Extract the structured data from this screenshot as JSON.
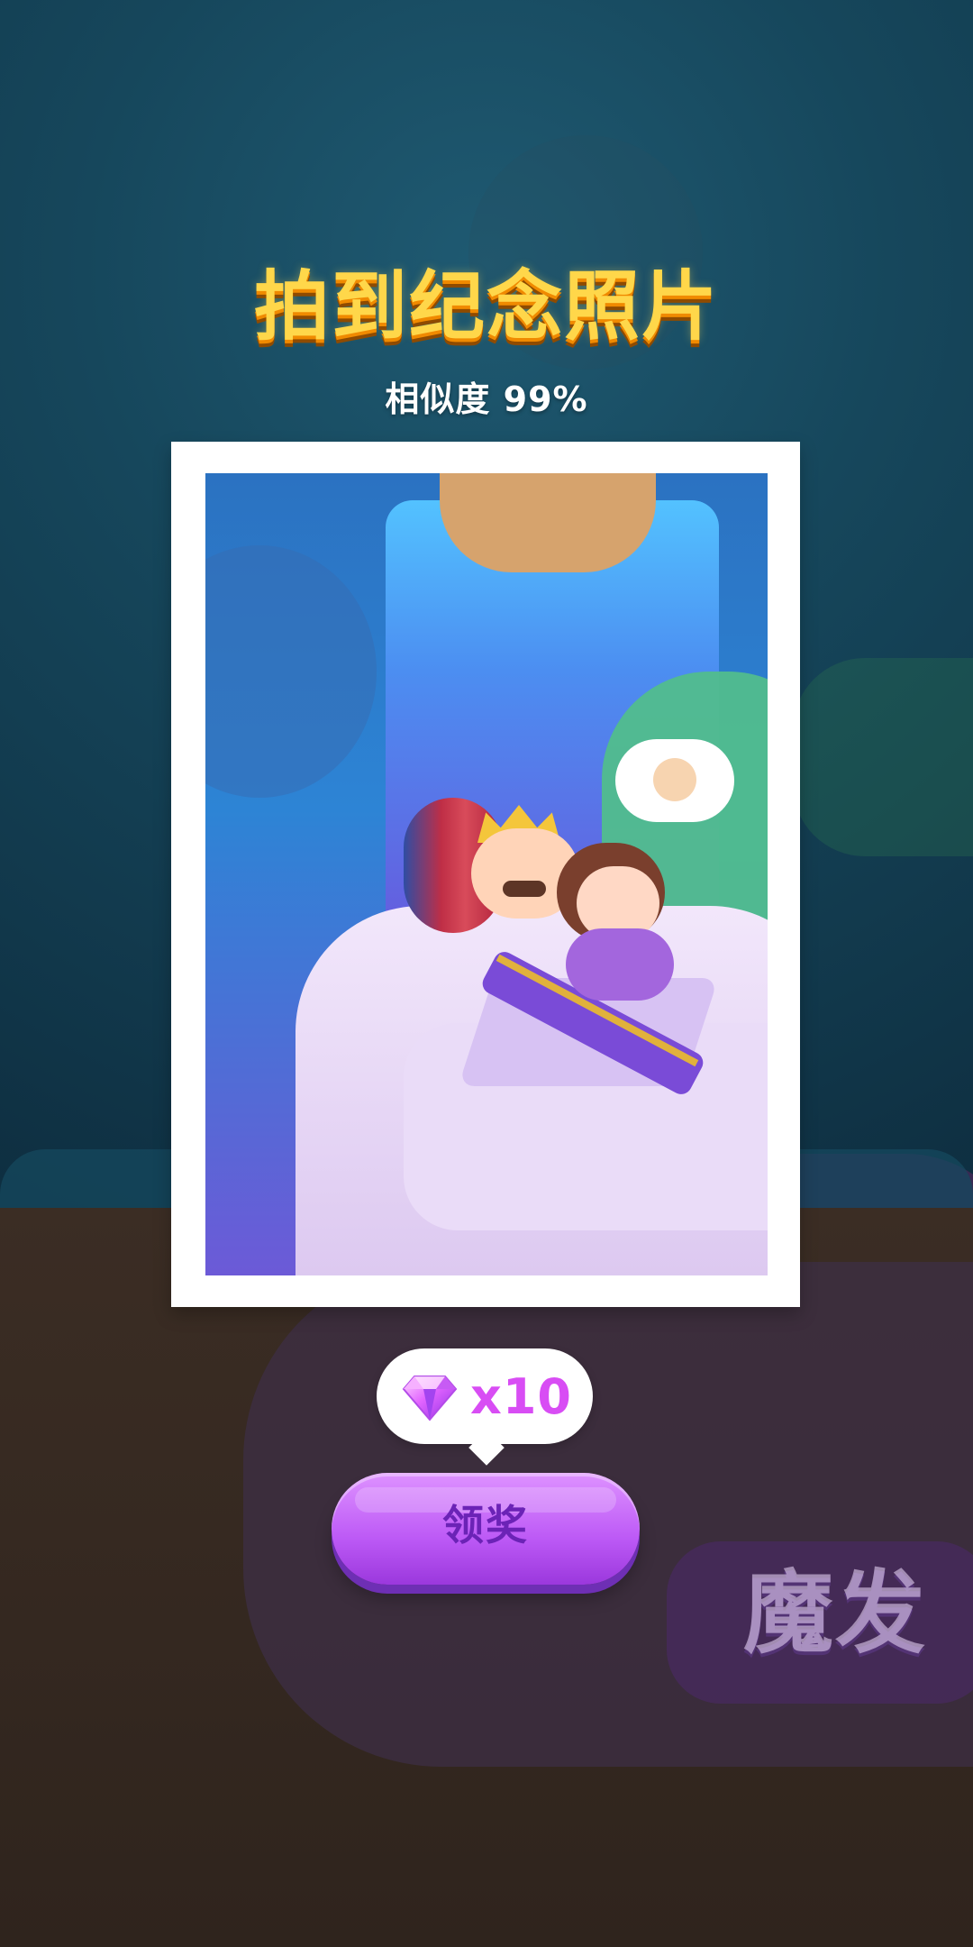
{
  "header": {
    "title": "拍到纪念照片",
    "similarity": "相似度 99%"
  },
  "reward": {
    "icon": "gem-icon",
    "count": "x10"
  },
  "actions": {
    "claim": "领奖"
  },
  "background": {
    "sign_text": "魔发"
  }
}
